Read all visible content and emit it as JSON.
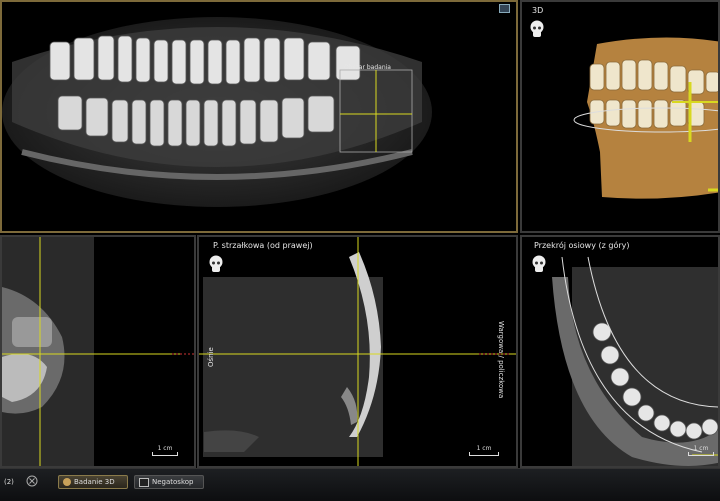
{
  "panels": {
    "panoramic": {
      "roi_label": "Obszar badania"
    },
    "view3d": {
      "title": "3D"
    },
    "sagittal": {
      "title": "P. strzałkowa (od prawej)",
      "side_left": "Ośnie",
      "side_right": "Wargowa / policzkowa",
      "scale": "1 cm"
    },
    "left_view": {
      "scale": "1 cm"
    },
    "axial": {
      "title": "Przekrój osiowy (z góry)",
      "scale": "1 cm"
    }
  },
  "taskbar": {
    "counter": "(2)",
    "items": [
      {
        "label": "Badanie 3D",
        "active": true
      },
      {
        "label": "Negatoskop",
        "active": false
      }
    ]
  },
  "colors": {
    "crosshair": "#d8d820",
    "accent": "#7d6a3a",
    "bone": "#b5823f"
  }
}
